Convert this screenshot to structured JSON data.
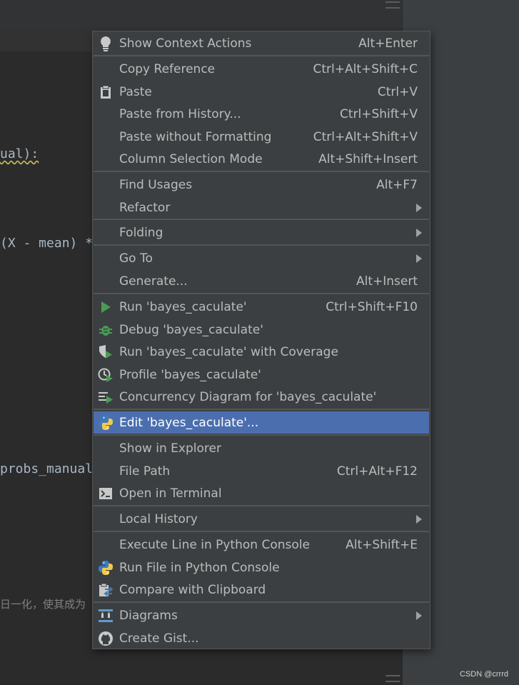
{
  "editor": {
    "lines": [
      "ual):",
      "(X - mean) *",
      "probs_manual",
      "日一化，使其成为"
    ]
  },
  "watermark": "CSDN @crrrd",
  "menu": {
    "items": [
      {
        "id": "show-context-actions",
        "label": "Show Context Actions",
        "shortcut": "Alt+Enter",
        "icon": "lightbulb-icon"
      },
      {
        "id": "copy-reference",
        "label": "Copy Reference",
        "shortcut": "Ctrl+Alt+Shift+C"
      },
      {
        "id": "paste",
        "label": "Paste",
        "shortcut": "Ctrl+V",
        "icon": "clipboard-icon"
      },
      {
        "id": "paste-from-history",
        "label": "Paste from History...",
        "shortcut": "Ctrl+Shift+V"
      },
      {
        "id": "paste-without-formatting",
        "label": "Paste without Formatting",
        "shortcut": "Ctrl+Alt+Shift+V"
      },
      {
        "id": "column-selection-mode",
        "label": "Column Selection Mode",
        "shortcut": "Alt+Shift+Insert"
      },
      {
        "id": "find-usages",
        "label": "Find Usages",
        "shortcut": "Alt+F7"
      },
      {
        "id": "refactor",
        "label": "Refactor",
        "submenu": true
      },
      {
        "id": "folding",
        "label": "Folding",
        "submenu": true
      },
      {
        "id": "go-to",
        "label": "Go To",
        "submenu": true
      },
      {
        "id": "generate",
        "label": "Generate...",
        "shortcut": "Alt+Insert"
      },
      {
        "id": "run",
        "label": "Run 'bayes_caculate'",
        "shortcut": "Ctrl+Shift+F10",
        "icon": "run-icon"
      },
      {
        "id": "debug",
        "label": "Debug 'bayes_caculate'",
        "icon": "bug-icon"
      },
      {
        "id": "run-coverage",
        "label": "Run 'bayes_caculate' with Coverage",
        "icon": "coverage-icon"
      },
      {
        "id": "profile",
        "label": "Profile 'bayes_caculate'",
        "icon": "profile-icon"
      },
      {
        "id": "concurrency",
        "label": "Concurrency Diagram for 'bayes_caculate'",
        "icon": "concurrency-icon"
      },
      {
        "id": "edit-config",
        "label": "Edit 'bayes_caculate'...",
        "icon": "python-icon",
        "selected": true
      },
      {
        "id": "show-in-explorer",
        "label": "Show in Explorer"
      },
      {
        "id": "file-path",
        "label": "File Path",
        "shortcut": "Ctrl+Alt+F12"
      },
      {
        "id": "open-in-terminal",
        "label": "Open in Terminal",
        "icon": "terminal-icon"
      },
      {
        "id": "local-history",
        "label": "Local History",
        "submenu": true
      },
      {
        "id": "execute-line",
        "label": "Execute Line in Python Console",
        "shortcut": "Alt+Shift+E"
      },
      {
        "id": "run-file-console",
        "label": "Run File in Python Console",
        "icon": "python-icon"
      },
      {
        "id": "compare-clipboard",
        "label": "Compare with Clipboard",
        "icon": "compare-icon"
      },
      {
        "id": "diagrams",
        "label": "Diagrams",
        "submenu": true,
        "icon": "diagram-icon"
      },
      {
        "id": "create-gist",
        "label": "Create Gist...",
        "icon": "github-icon"
      }
    ]
  },
  "colors": {
    "menu_bg": "#3c3f41",
    "selected_bg": "#4b6eaf",
    "run_green": "#499c54",
    "python_blue": "#3e7bbd",
    "python_yellow": "#f2c94c"
  }
}
